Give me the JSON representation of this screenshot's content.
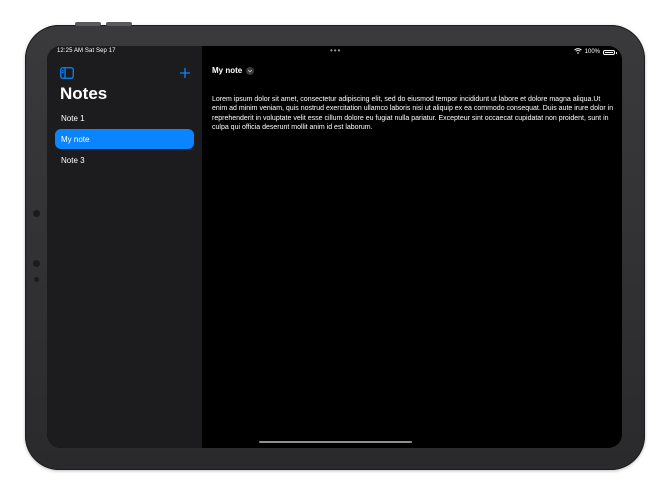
{
  "status_bar": {
    "time": "12:25 AM  Sat Sep 17",
    "dots": "•••",
    "wifi_icon": "wifi-icon",
    "battery_percent": "100%"
  },
  "sidebar": {
    "title": "Notes",
    "toggle_icon": "sidebar-toggle-icon",
    "add_icon": "plus-icon",
    "items": [
      {
        "label": "Note 1",
        "selected": false
      },
      {
        "label": "My note",
        "selected": true
      },
      {
        "label": "Note 3",
        "selected": false
      }
    ]
  },
  "detail": {
    "title": "My note",
    "title_menu_icon": "chevron-down-icon",
    "body": "Lorem ipsum dolor sit amet, consectetur adipiscing elit, sed do eiusmod tempor incididunt ut labore et dolore magna aliqua.Ut enim ad minim veniam, quis nostrud exercitation ullamco laboris nisi ut aliquip ex ea commodo consequat. Duis aute irure dolor in reprehenderit in voluptate velit esse cillum dolore eu fugiat nulla pariatur. Excepteur sint occaecat cupidatat non proident, sunt in culpa qui officia deserunt mollit anim id est laborum."
  },
  "colors": {
    "accent": "#0a84ff",
    "sidebar_bg": "#1c1c1e",
    "detail_bg": "#000000"
  }
}
